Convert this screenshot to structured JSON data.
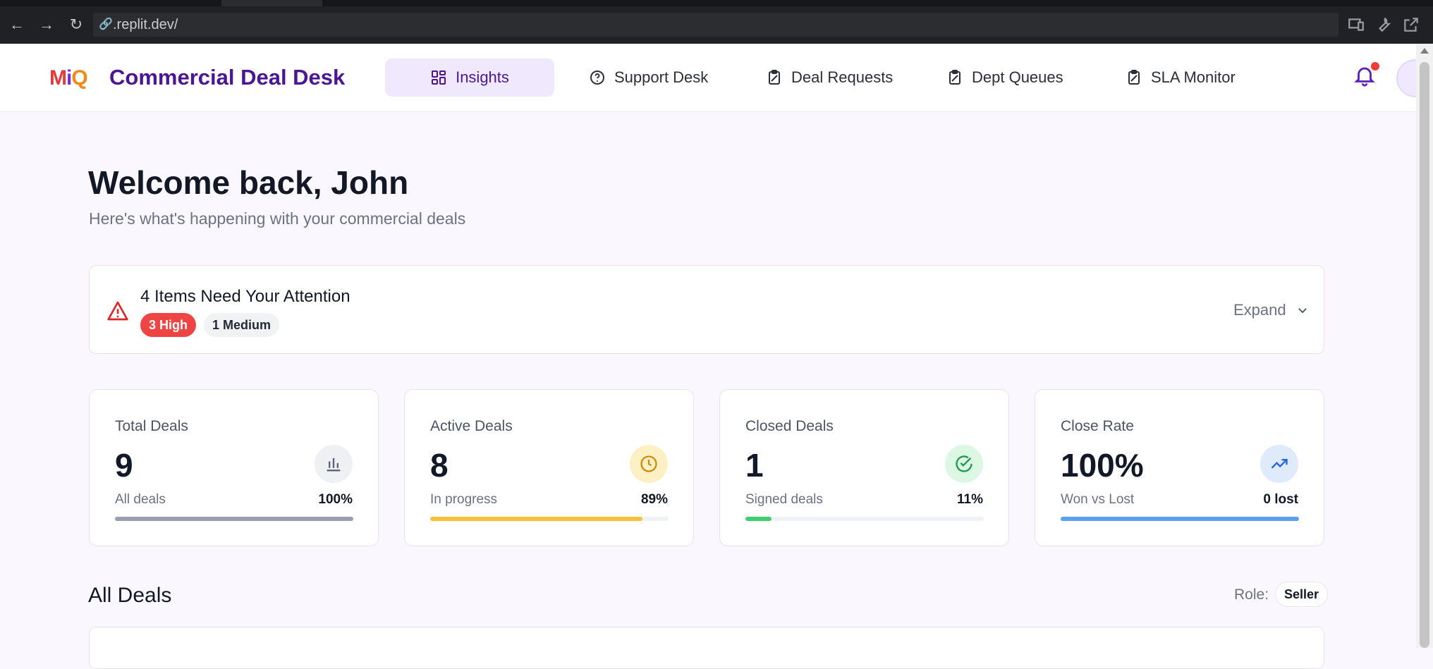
{
  "browser": {
    "url": ".replit.dev/"
  },
  "header": {
    "logo": {
      "m": "M",
      "i": "i",
      "q": "Q"
    },
    "title": "Commercial Deal Desk",
    "nav": [
      {
        "label": "Insights",
        "icon": "grid-icon",
        "active": true
      },
      {
        "label": "Support Desk",
        "icon": "help-circle-icon",
        "active": false
      },
      {
        "label": "Deal Requests",
        "icon": "clipboard-icon",
        "active": false
      },
      {
        "label": "Dept Queues",
        "icon": "clipboard-icon",
        "active": false
      },
      {
        "label": "SLA Monitor",
        "icon": "clipboard-icon",
        "active": false
      }
    ]
  },
  "welcome": {
    "title": "Welcome back, John",
    "subtitle": "Here's what's happening with your commercial deals"
  },
  "attention": {
    "title": "4 Items Need Your Attention",
    "high_badge": "3 High",
    "medium_badge": "1 Medium",
    "expand_label": "Expand"
  },
  "stats": [
    {
      "label": "Total Deals",
      "value": "9",
      "sub": "All deals",
      "pct": "100%",
      "fill": 1.0,
      "color": "#97a0b0",
      "icon": "bar-chart-icon",
      "icon_bg": "#eef0f4",
      "icon_color": "#5b6475"
    },
    {
      "label": "Active Deals",
      "value": "8",
      "sub": "In progress",
      "pct": "89%",
      "fill": 0.89,
      "color": "#f7c33a",
      "icon": "clock-icon",
      "icon_bg": "#fdf0c2",
      "icon_color": "#d28a0c"
    },
    {
      "label": "Closed Deals",
      "value": "1",
      "sub": "Signed deals",
      "pct": "11%",
      "fill": 0.11,
      "color": "#3fcf6e",
      "icon": "check-circle-icon",
      "icon_bg": "#dcf7e4",
      "icon_color": "#1f9a4a"
    },
    {
      "label": "Close Rate",
      "value": "100%",
      "sub": "Won vs Lost",
      "pct": "0 lost",
      "fill": 1.0,
      "color": "#5aa2f0",
      "icon": "trending-up-icon",
      "icon_bg": "#dfeafb",
      "icon_color": "#2563eb"
    }
  ],
  "deals": {
    "title": "All Deals",
    "role_label": "Role:",
    "role_value": "Seller"
  }
}
